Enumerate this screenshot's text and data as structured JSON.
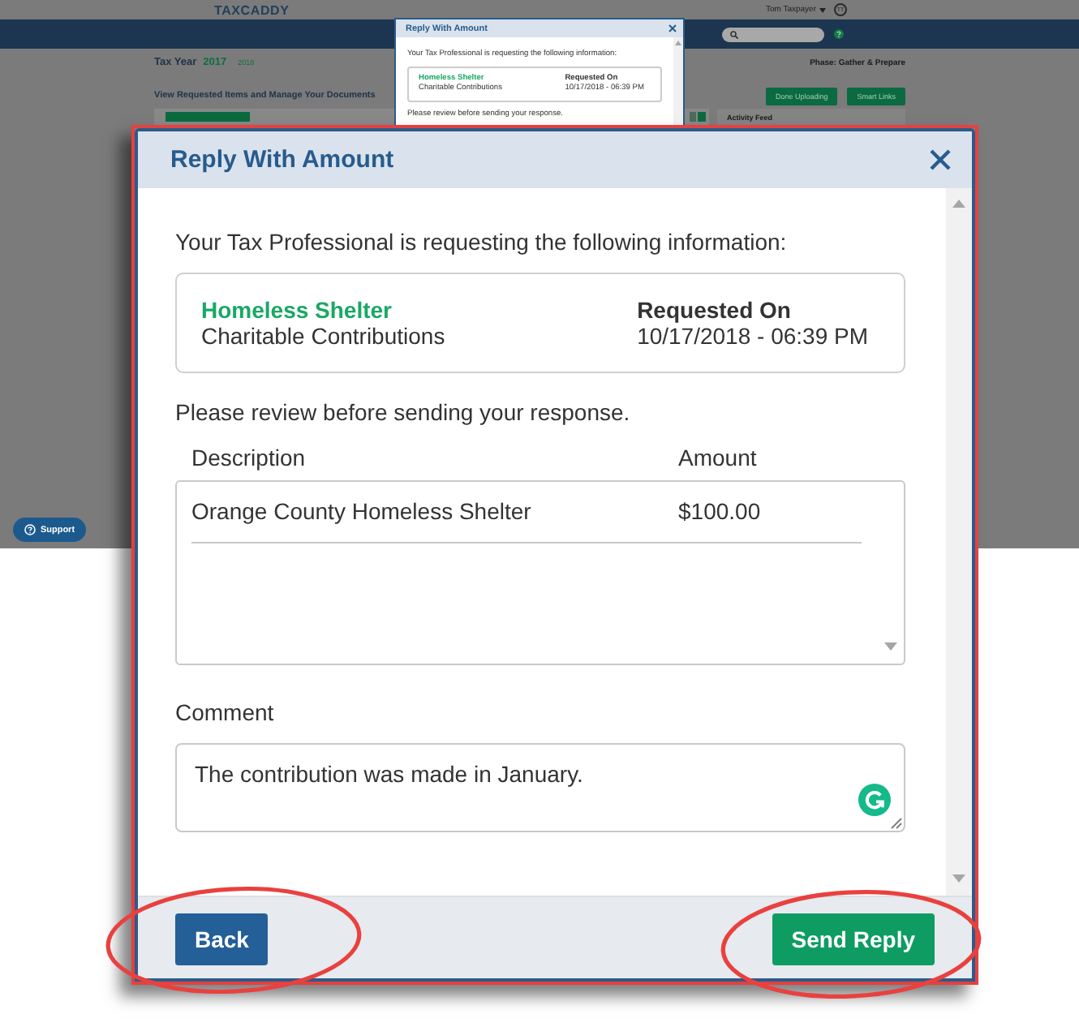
{
  "background_page": {
    "logo": "TAXCADDY",
    "user_name": "Tom Taxpayer",
    "avatar_initials": "TT",
    "tax_year_label": "Tax Year",
    "years": [
      {
        "label": "2017",
        "selected": true
      },
      {
        "label": "2018",
        "selected": false
      }
    ],
    "phase": "Phase: Gather & Prepare",
    "section_title": "View Requested Items and Manage Your Documents",
    "buttons": [
      "Done Uploading",
      "Smart Links"
    ],
    "activity_feed_title": "Activity Feed",
    "support_button": "Support"
  },
  "preview_dialog": {
    "title": "Reply With Amount",
    "intro": "Your Tax Professional is requesting the following information:",
    "request": {
      "item": "Homeless Shelter",
      "category": "Charitable Contributions",
      "requested_on_label": "Requested On",
      "requested_on": "10/17/2018 - 06:39 PM"
    },
    "review_note": "Please review before sending your response."
  },
  "dialog": {
    "title": "Reply With Amount",
    "highlighted": true,
    "intro": "Your Tax Professional is requesting the following information:",
    "request": {
      "item": "Homeless Shelter",
      "category": "Charitable Contributions",
      "requested_on_label": "Requested On",
      "requested_on": "10/17/2018 - 06:39 PM"
    },
    "review_note": "Please review before sending your response.",
    "columns": [
      "Description",
      "Amount"
    ],
    "rows": [
      {
        "description": "Orange County Homeless Shelter",
        "amount": "$100.00"
      }
    ],
    "comment_label": "Comment",
    "comment": "The contribution was made in January.",
    "buttons": [
      {
        "label": "Back",
        "kind": "secondary",
        "circled": true
      },
      {
        "label": "Send Reply",
        "kind": "primary",
        "circled": true
      }
    ]
  }
}
